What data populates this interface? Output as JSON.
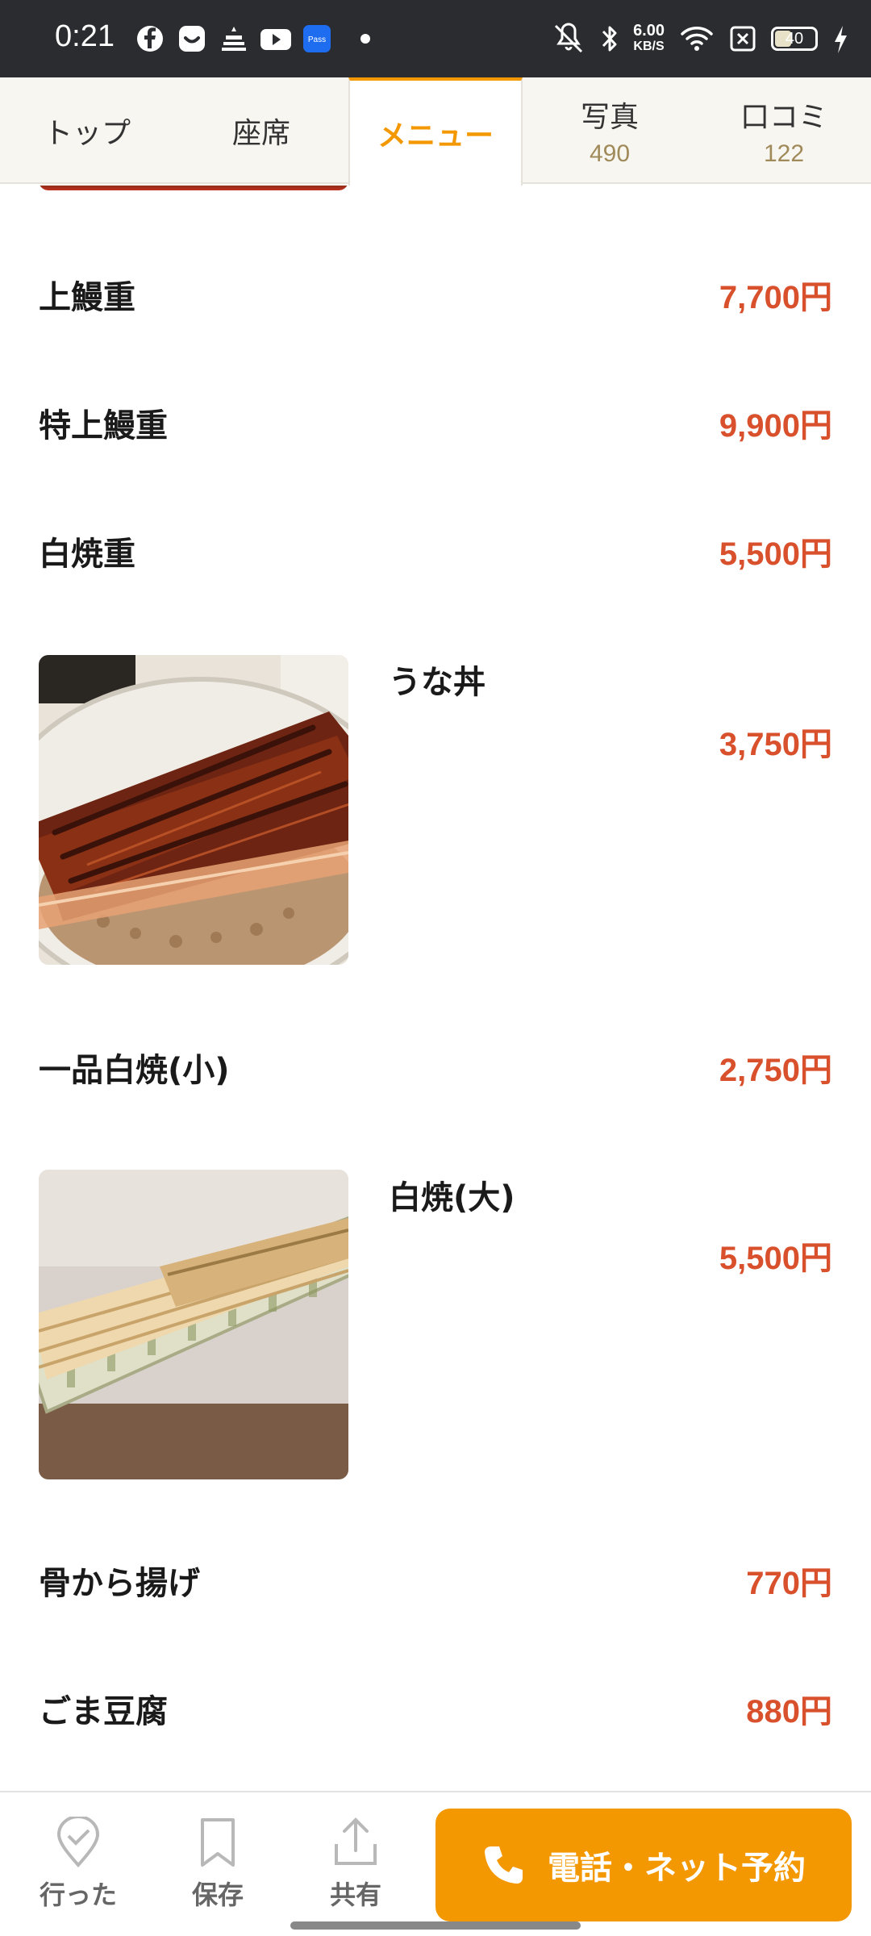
{
  "status_bar": {
    "time": "0:21",
    "speed_value": "6.00",
    "speed_unit": "KB/S",
    "battery": "40",
    "icons": [
      "facebook-icon",
      "smile-app-icon",
      "cake-app-icon",
      "youtube-icon",
      "pass-app-icon",
      "dot-icon",
      "mute-icon",
      "bluetooth-icon",
      "wifi-icon",
      "x-box-icon",
      "battery-icon",
      "charging-icon"
    ]
  },
  "tabs": [
    {
      "label": "トップ",
      "count": ""
    },
    {
      "label": "座席",
      "count": ""
    },
    {
      "label": "メニュー",
      "count": ""
    },
    {
      "label": "写真",
      "count": "490"
    },
    {
      "label": "口コミ",
      "count": "122"
    }
  ],
  "active_tab": "メニュー",
  "menu": [
    {
      "name": "上鰻重",
      "price": "7,700円"
    },
    {
      "name": "特上鰻重",
      "price": "9,900円"
    },
    {
      "name": "白焼重",
      "price": "5,500円"
    },
    {
      "name": "うな丼",
      "price": "3,750円",
      "photo": "unadon-photo"
    },
    {
      "name": "一品白焼(小)",
      "price": "2,750円"
    },
    {
      "name": "白焼(大)",
      "price": "5,500円",
      "photo": "shirayaki-photo"
    },
    {
      "name": "骨から揚げ",
      "price": "770円"
    },
    {
      "name": "ごま豆腐",
      "price": "880円"
    }
  ],
  "bottom_bar": {
    "visited": "行った",
    "save": "保存",
    "share": "共有",
    "reserve": "電話・ネット予約"
  },
  "colors": {
    "accent": "#f39800",
    "price": "#d9502c",
    "status_bar": "#2b2c30"
  }
}
